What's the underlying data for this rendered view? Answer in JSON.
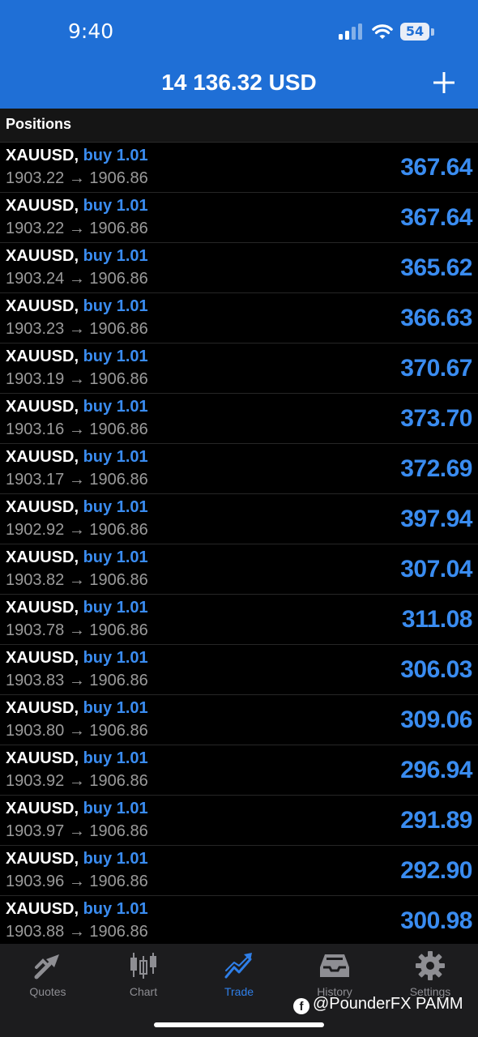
{
  "status_bar": {
    "time": "9:40",
    "battery": "54"
  },
  "header": {
    "balance": "14 136.32 USD"
  },
  "section": {
    "title": "Positions"
  },
  "positions": [
    {
      "symbol": "XAUUSD,",
      "side": "buy 1.01",
      "open": "1903.22",
      "current": "1906.86",
      "profit": "367.64"
    },
    {
      "symbol": "XAUUSD,",
      "side": "buy 1.01",
      "open": "1903.22",
      "current": "1906.86",
      "profit": "367.64"
    },
    {
      "symbol": "XAUUSD,",
      "side": "buy 1.01",
      "open": "1903.24",
      "current": "1906.86",
      "profit": "365.62"
    },
    {
      "symbol": "XAUUSD,",
      "side": "buy 1.01",
      "open": "1903.23",
      "current": "1906.86",
      "profit": "366.63"
    },
    {
      "symbol": "XAUUSD,",
      "side": "buy 1.01",
      "open": "1903.19",
      "current": "1906.86",
      "profit": "370.67"
    },
    {
      "symbol": "XAUUSD,",
      "side": "buy 1.01",
      "open": "1903.16",
      "current": "1906.86",
      "profit": "373.70"
    },
    {
      "symbol": "XAUUSD,",
      "side": "buy 1.01",
      "open": "1903.17",
      "current": "1906.86",
      "profit": "372.69"
    },
    {
      "symbol": "XAUUSD,",
      "side": "buy 1.01",
      "open": "1902.92",
      "current": "1906.86",
      "profit": "397.94"
    },
    {
      "symbol": "XAUUSD,",
      "side": "buy 1.01",
      "open": "1903.82",
      "current": "1906.86",
      "profit": "307.04"
    },
    {
      "symbol": "XAUUSD,",
      "side": "buy 1.01",
      "open": "1903.78",
      "current": "1906.86",
      "profit": "311.08"
    },
    {
      "symbol": "XAUUSD,",
      "side": "buy 1.01",
      "open": "1903.83",
      "current": "1906.86",
      "profit": "306.03"
    },
    {
      "symbol": "XAUUSD,",
      "side": "buy 1.01",
      "open": "1903.80",
      "current": "1906.86",
      "profit": "309.06"
    },
    {
      "symbol": "XAUUSD,",
      "side": "buy 1.01",
      "open": "1903.92",
      "current": "1906.86",
      "profit": "296.94"
    },
    {
      "symbol": "XAUUSD,",
      "side": "buy 1.01",
      "open": "1903.97",
      "current": "1906.86",
      "profit": "291.89"
    },
    {
      "symbol": "XAUUSD,",
      "side": "buy 1.01",
      "open": "1903.96",
      "current": "1906.86",
      "profit": "292.90"
    },
    {
      "symbol": "XAUUSD,",
      "side": "buy 1.01",
      "open": "1903.88",
      "current": "1906.86",
      "profit": "300.98"
    }
  ],
  "arrow": "→",
  "tabs": [
    {
      "label": "Quotes",
      "icon": "quotes-icon",
      "active": false
    },
    {
      "label": "Chart",
      "icon": "chart-icon",
      "active": false
    },
    {
      "label": "Trade",
      "icon": "trade-icon",
      "active": true
    },
    {
      "label": "History",
      "icon": "history-icon",
      "active": false
    },
    {
      "label": "Settings",
      "icon": "settings-icon",
      "active": false
    }
  ],
  "watermark": {
    "text": "@PounderFX PAMM",
    "icon": "facebook-icon"
  },
  "colors": {
    "header_bg": "#1f6fd6",
    "accent": "#3a8cf0",
    "background": "#000000"
  }
}
